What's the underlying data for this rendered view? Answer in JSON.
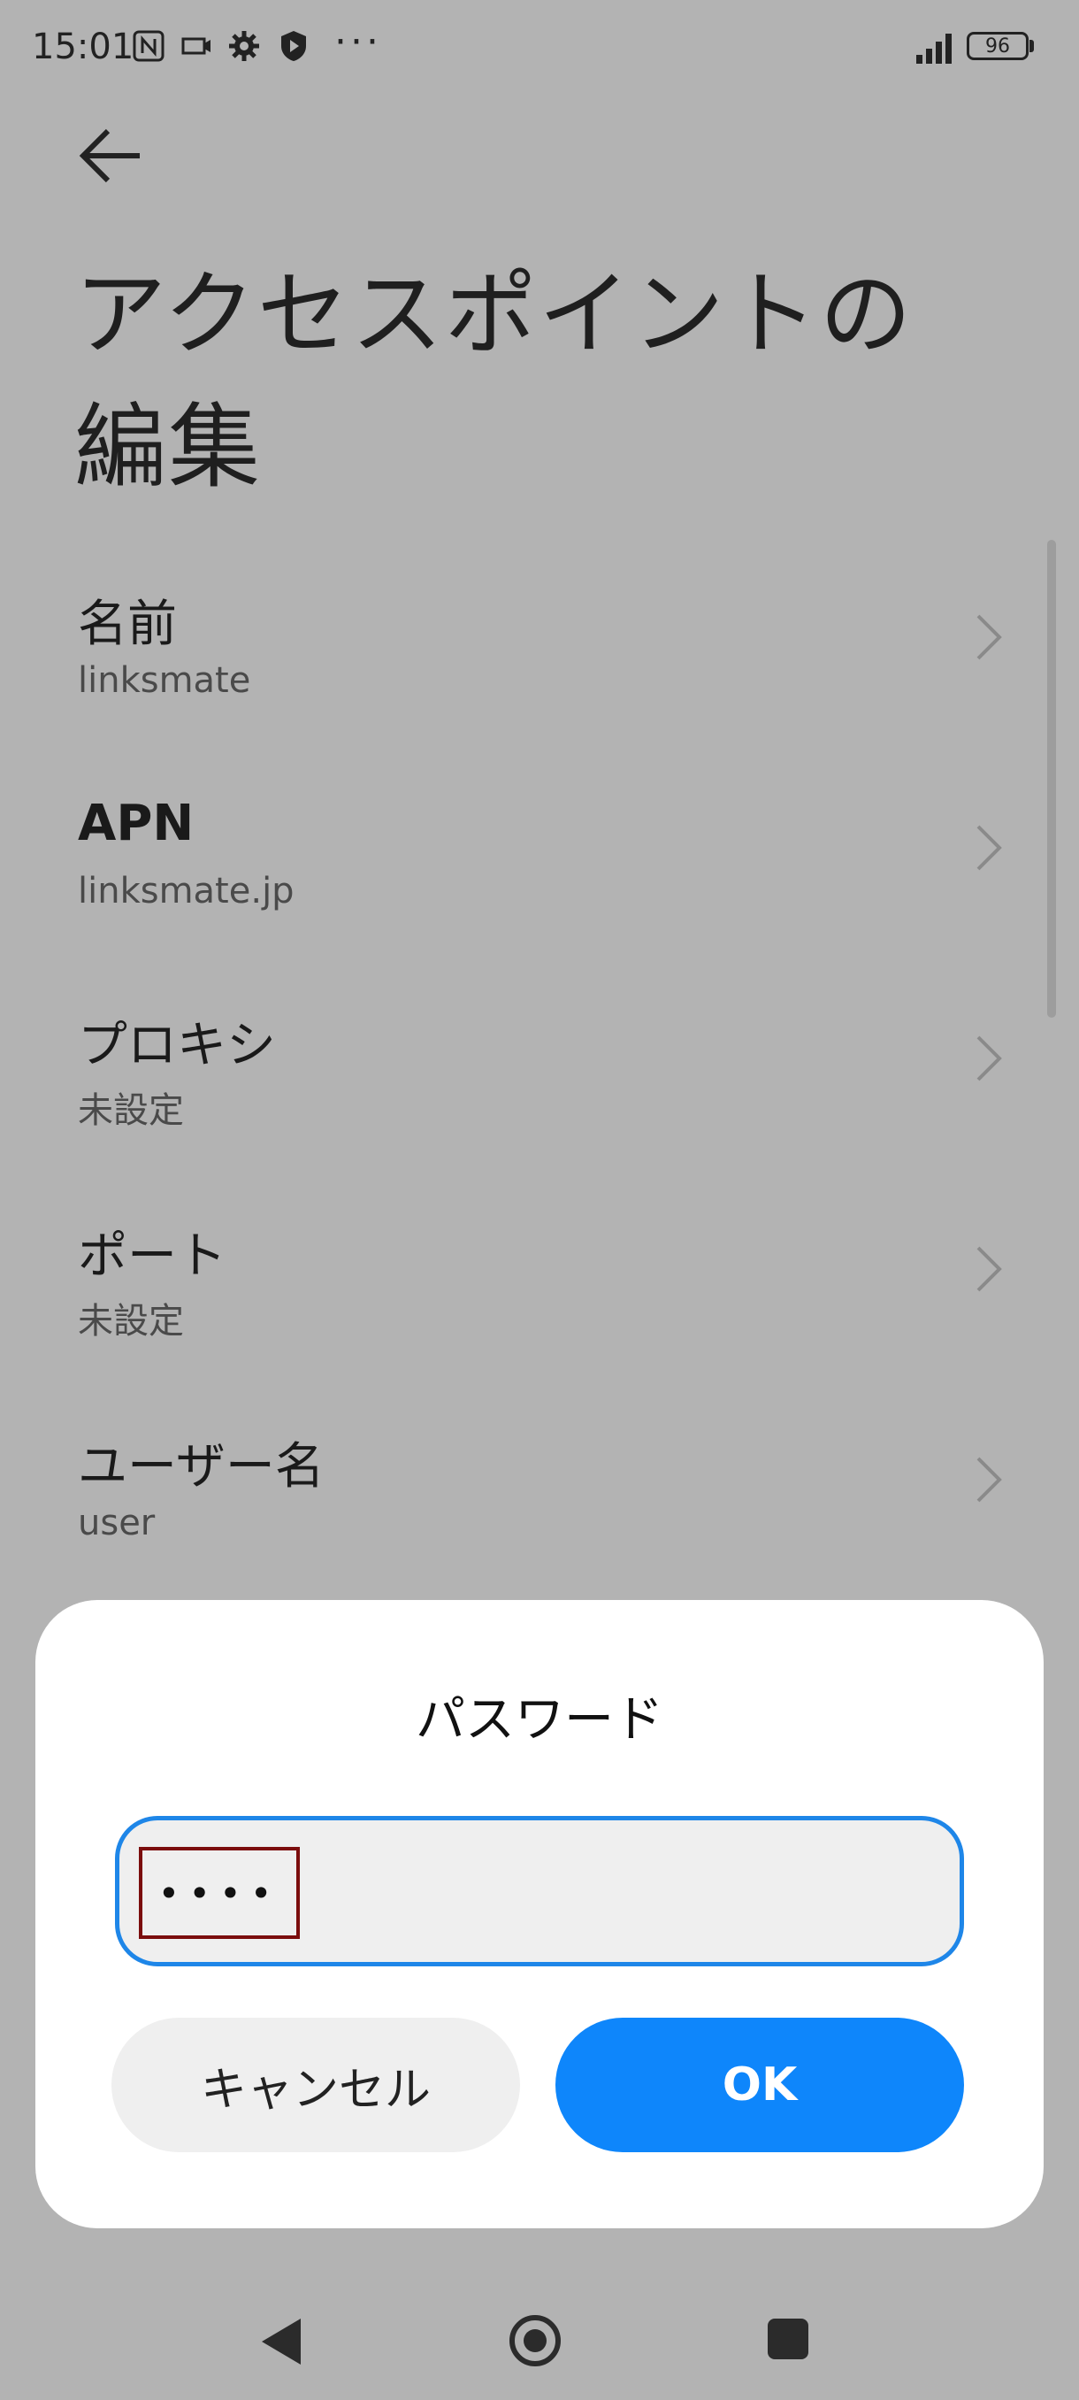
{
  "status_bar": {
    "time": "15:01",
    "more": "···",
    "battery": "96",
    "icons": [
      "nfc-icon",
      "camera-badge-icon",
      "gear-icon",
      "shield-play-icon",
      "signal-icon",
      "battery-icon"
    ]
  },
  "page": {
    "back_icon": "arrow-left-icon",
    "title": "アクセスポイントの編集"
  },
  "settings": [
    {
      "label": "名前",
      "value": "linksmate"
    },
    {
      "label": "APN",
      "value": "linksmate.jp"
    },
    {
      "label": "プロキシ",
      "value": "未設定"
    },
    {
      "label": "ポート",
      "value": "未設定"
    },
    {
      "label": "ユーザー名",
      "value": "user"
    }
  ],
  "dialog": {
    "title": "パスワード",
    "password_value": "••••",
    "cancel_label": "キャンセル",
    "ok_label": "OK",
    "accent_color": "#0e86fb",
    "field_border_color": "#1e86e8"
  },
  "navbar": {
    "icons": [
      "nav-back-icon",
      "nav-home-icon",
      "nav-recents-icon"
    ]
  }
}
